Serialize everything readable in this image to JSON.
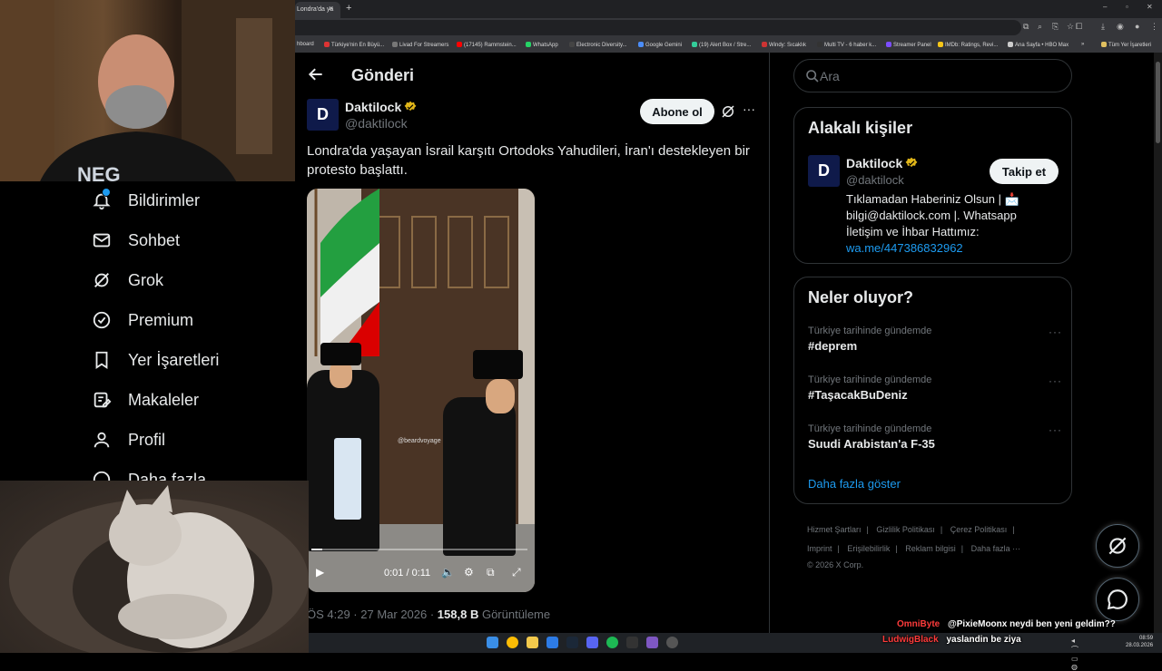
{
  "browser": {
    "tab_title": "Londra'da ya",
    "tab_close": "×",
    "tab_add": "+",
    "bookmarks": [
      "hboard",
      "Türkiye'nin En Büyü...",
      "Livad For Streamers",
      "(17145) Rammstein...",
      "WhatsApp",
      "Electronic Diversity...",
      "Google Gemini",
      "(19) Alert Box / Stre...",
      "Windy: Sıcaklık",
      "Multi TV - 6 haber k...",
      "Streamer Panel",
      "IMDb: Ratings, Revi...",
      "Ana Sayfa • HBO Max",
      "»",
      "Tüm Yer İşaretleri"
    ]
  },
  "sidebar": {
    "items": [
      {
        "label": "Bildirimler",
        "icon": "bell-icon"
      },
      {
        "label": "Sohbet",
        "icon": "envelope-icon"
      },
      {
        "label": "Grok",
        "icon": "grok-icon"
      },
      {
        "label": "Premium",
        "icon": "premium-icon"
      },
      {
        "label": "Yer İşaretleri",
        "icon": "bookmark-icon"
      },
      {
        "label": "Makaleler",
        "icon": "articles-icon"
      },
      {
        "label": "Profil",
        "icon": "profile-icon"
      },
      {
        "label": "Daha fazla",
        "icon": "more-icon"
      }
    ]
  },
  "main": {
    "title": "Gönderi",
    "author": {
      "name": "Daktilock",
      "handle": "@daktilock",
      "avatar_letter": "D"
    },
    "subscribe_label": "Abone ol",
    "tweet_text": "Londra'da yaşayan İsrail karşıtı Ortodoks Yahudileri, İran'ı destekleyen bir protesto başlattı.",
    "video": {
      "watermark": "@beardvoyage",
      "time": "0:01 / 0:11",
      "progress": 0.05
    },
    "meta": {
      "time": "ÖS 4:29 · 27 Mar 2026 · ",
      "views": "158,8 B",
      "views_label": " Görüntüleme"
    }
  },
  "right": {
    "search_placeholder": "Ara",
    "related": {
      "title": "Alakalı kişiler",
      "name": "Daktilock",
      "handle": "@daktilock",
      "follow_label": "Takip et",
      "bio": "Tıklamadan Haberiniz Olsun | 📩 bilgi@daktilock.com |. Whatsapp İletişim ve İhbar Hattımız:",
      "bio_link": "wa.me/447386832962"
    },
    "trends": {
      "title": "Neler oluyor?",
      "items": [
        {
          "context": "Türkiye tarihinde gündemde",
          "name": "#deprem"
        },
        {
          "context": "Türkiye tarihinde gündemde",
          "name": "#TaşacakBuDeniz"
        },
        {
          "context": "Türkiye tarihinde gündemde",
          "name": "Suudi Arabistan'a F-35"
        }
      ],
      "show_more": "Daha fazla göster",
      "more_glyph": "···"
    },
    "footer": {
      "row1": [
        "Hizmet Şartları",
        "|",
        "Gizlilik Politikası",
        "|",
        "Çerez Politikası",
        "|"
      ],
      "row2": [
        "Imprint",
        "|",
        "Erişilebilirlik",
        "|",
        "Reklam bilgisi",
        "|",
        "Daha fazla ···"
      ],
      "copyright": "© 2026 X Corp."
    }
  },
  "chat": [
    {
      "user": "OmniByte",
      "message": "@PixieMoonx neydi ben yeni geldim??",
      "user_color": "#ff3b3b"
    },
    {
      "user": "LudwigBlack",
      "message": "yaslandin be ziya",
      "user_color": "#ff3b3b"
    }
  ],
  "taskbar": {
    "time": "08:59",
    "date": "28.03.2026"
  },
  "colors": {
    "accent": "#1d9bf0",
    "verified": "#e2b719",
    "background": "#000000"
  }
}
